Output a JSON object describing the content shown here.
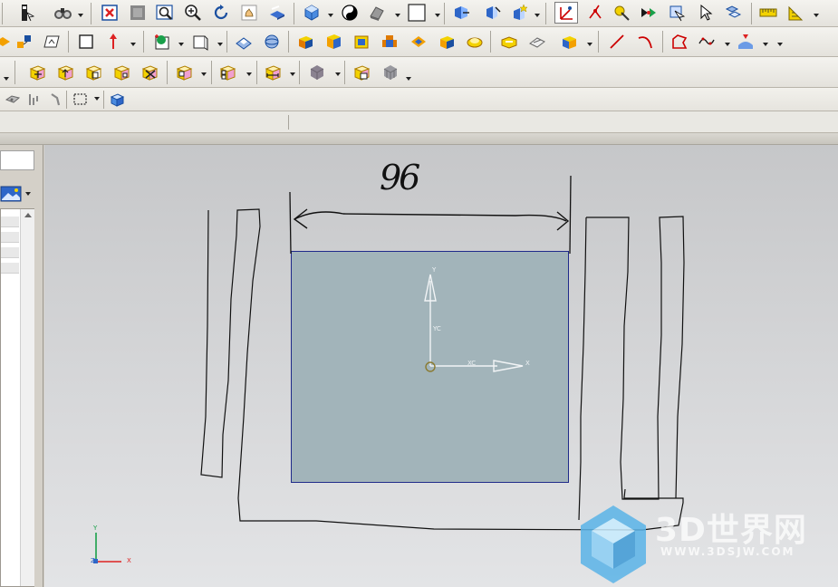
{
  "viewport": {
    "dimension_label": "96",
    "work_csys": {
      "y_label": "Y",
      "yc_label": "YC",
      "xc_label": "XC",
      "x_label": "X"
    },
    "view_triad": {
      "y_label": "Y",
      "x_label": "X",
      "z_label": "Z"
    }
  },
  "watermark": {
    "title": "3D世界网",
    "url": "WWW.3DSJW.COM"
  },
  "icons": {
    "toolbar_row1": [
      "info-icon",
      "binoculars-icon",
      "fit-view-icon",
      "zoom-window-icon",
      "zoom-icon",
      "rotate-icon",
      "pan-icon",
      "shaded-view-icon",
      "render-style-icon",
      "yin-yang-icon",
      "section-view-icon",
      "background-icon",
      "orient-view-icon",
      "snap-view-icon",
      "spotlight-icon",
      "datum-csys-icon",
      "point-icon",
      "select-icon",
      "measure-icon",
      "ruler-icon"
    ],
    "toolbar_row2": [
      "sketch-icon",
      "rectangle-icon",
      "arrow-icon",
      "datum-plane-icon",
      "extrude-icon",
      "revolve-icon",
      "block-icon",
      "cylinder-icon",
      "cone-icon",
      "sphere-icon",
      "line-icon",
      "arc-icon",
      "spline-icon"
    ],
    "toolbar_row3": [
      "move-face-icon",
      "offset-region-icon",
      "replace-face-icon",
      "resize-face-icon",
      "delete-face-icon",
      "synchronous-icon"
    ]
  },
  "colors": {
    "viewport_top": "#c6c7c9",
    "viewport_bottom": "#e3e4e6",
    "sketch_fill": "#a2b4ba",
    "sketch_border": "#1f2a8a",
    "watermark": "#4aa8dc"
  }
}
